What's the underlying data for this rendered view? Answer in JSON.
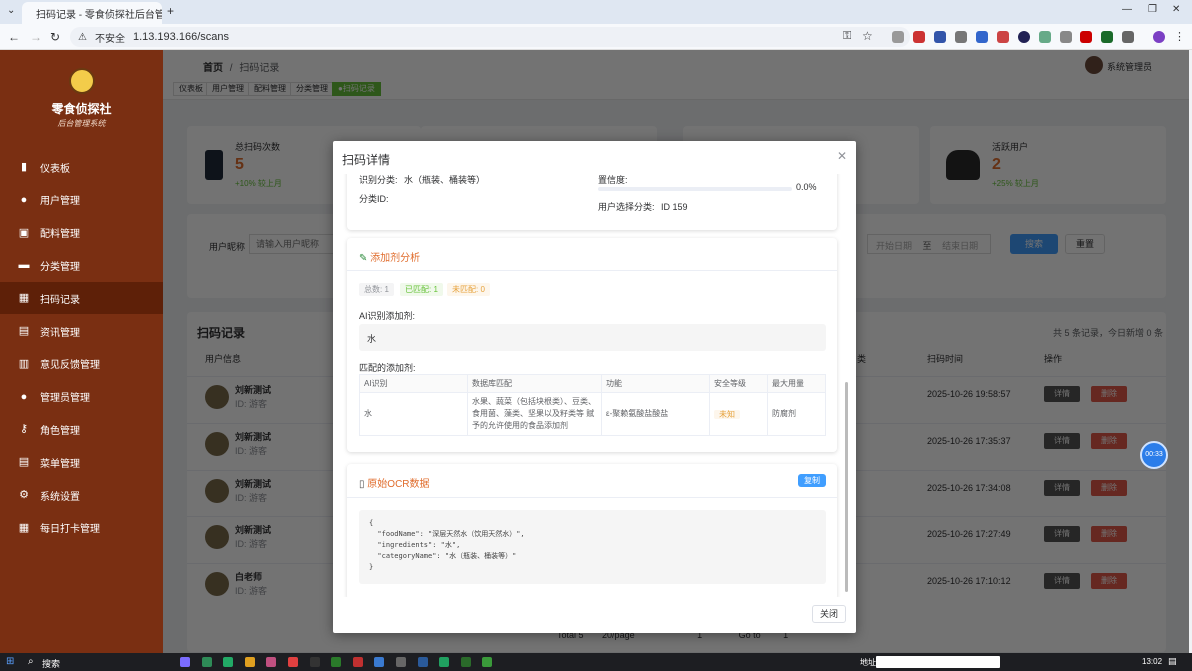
{
  "browser": {
    "tab_title": "扫码记录 - 零食侦探社后台管理",
    "security_label": "不安全",
    "url": "1.13.193.166/scans"
  },
  "sidebar": {
    "brand": "零食侦探社",
    "subtitle": "后台管理系统",
    "items": [
      {
        "label": "仪表板",
        "icon": "dashboard-icon"
      },
      {
        "label": "用户管理",
        "icon": "user-icon"
      },
      {
        "label": "配料管理",
        "icon": "ingredient-icon"
      },
      {
        "label": "分类管理",
        "icon": "folder-icon"
      },
      {
        "label": "扫码记录",
        "icon": "scan-icon",
        "active": true
      },
      {
        "label": "资讯管理",
        "icon": "news-icon"
      },
      {
        "label": "意见反馈管理",
        "icon": "feedback-icon"
      },
      {
        "label": "管理员管理",
        "icon": "admin-icon"
      },
      {
        "label": "角色管理",
        "icon": "key-icon"
      },
      {
        "label": "菜单管理",
        "icon": "menu-icon"
      },
      {
        "label": "系统设置",
        "icon": "gear-icon"
      },
      {
        "label": "每日打卡管理",
        "icon": "checkin-icon"
      }
    ]
  },
  "header": {
    "breadcrumb_home": "首页",
    "breadcrumb_current": "扫码记录",
    "user_name": "系统管理员",
    "tabs": [
      "仪表板",
      "用户管理",
      "配料管理",
      "分类管理",
      "●扫码记录"
    ]
  },
  "stats": {
    "total_label": "总扫码次数",
    "total_value": "5",
    "total_trend": "+10% 较上月",
    "active_label": "活跃用户",
    "active_value": "2",
    "active_trend": "+25% 较上月"
  },
  "search": {
    "nickname_label": "用户昵称",
    "nickname_placeholder": "请输入用户昵称",
    "start_placeholder": "开始日期",
    "range_sep": "至",
    "end_placeholder": "结束日期",
    "search_button": "搜索",
    "reset_button": "重置"
  },
  "records": {
    "title": "扫码记录",
    "summary": "共 5 条记录，今日新增 0 条",
    "col_user": "用户信息",
    "col_category": "类",
    "col_time": "扫码时间",
    "col_action": "操作",
    "detail_label": "详情",
    "delete_label": "删除",
    "rows": [
      {
        "name": "刘新测试",
        "sub": "ID: 游客",
        "time": "2025-10-26 19:58:57"
      },
      {
        "name": "刘新测试",
        "sub": "ID: 游客",
        "time": "2025-10-26 17:35:37"
      },
      {
        "name": "刘新测试",
        "sub": "ID: 游客",
        "time": "2025-10-26 17:34:08"
      },
      {
        "name": "刘新测试",
        "sub": "ID: 游客",
        "time": "2025-10-26 17:27:49"
      },
      {
        "name": "白老师",
        "sub": "ID: 游客",
        "time": "2025-10-26 17:10:12"
      }
    ],
    "pagination": {
      "total": "Total 5",
      "page_size": "20/page",
      "page": "1",
      "goto": "Go to",
      "goto_value": "1"
    }
  },
  "modal": {
    "title": "扫码详情",
    "recognized_category_label": "识别分类:",
    "recognized_category_value": "水（瓶装、桶装等）",
    "category_id_label": "分类ID:",
    "confidence_label": "置信度:",
    "confidence_value": "0.0%",
    "confidence_fraction": 0.0,
    "user_category_label": "用户选择分类:",
    "user_category_value": "ID 159",
    "additive_section_title": "添加剂分析",
    "badge_total": "总数: 1",
    "badge_matched": "已匹配: 1",
    "badge_unmatched": "未匹配: 0",
    "ai_additives_label": "AI识别添加剂:",
    "ai_additives_value": "水",
    "matched_additives_label": "匹配的添加剂:",
    "table_headers": [
      "AI识别",
      "数据库匹配",
      "功能",
      "安全等级",
      "最大用量"
    ],
    "table_rows": [
      {
        "ai": "水",
        "db": "水果、蔬菜（包括块根类）、豆类、食用菌、藻类、坚果以及籽类等 赋予的允许使用的食品添加剂",
        "function": "ε-聚赖氨酸盐酸盐",
        "level": "未知",
        "max": "防腐剂"
      }
    ],
    "ocr_section_title": "原始OCR数据",
    "copy_button": "复制",
    "ocr_text": "{\n  \"foodName\": \"深层天然水（饮用天然水）\",\n  \"ingredients\": \"水\",\n  \"categoryName\": \"水（瓶装、桶装等）\"\n}",
    "close_button": "关闭"
  },
  "timer": "00:33",
  "taskbar": {
    "search": "搜索",
    "address_label": "地址",
    "time": "13:02"
  }
}
